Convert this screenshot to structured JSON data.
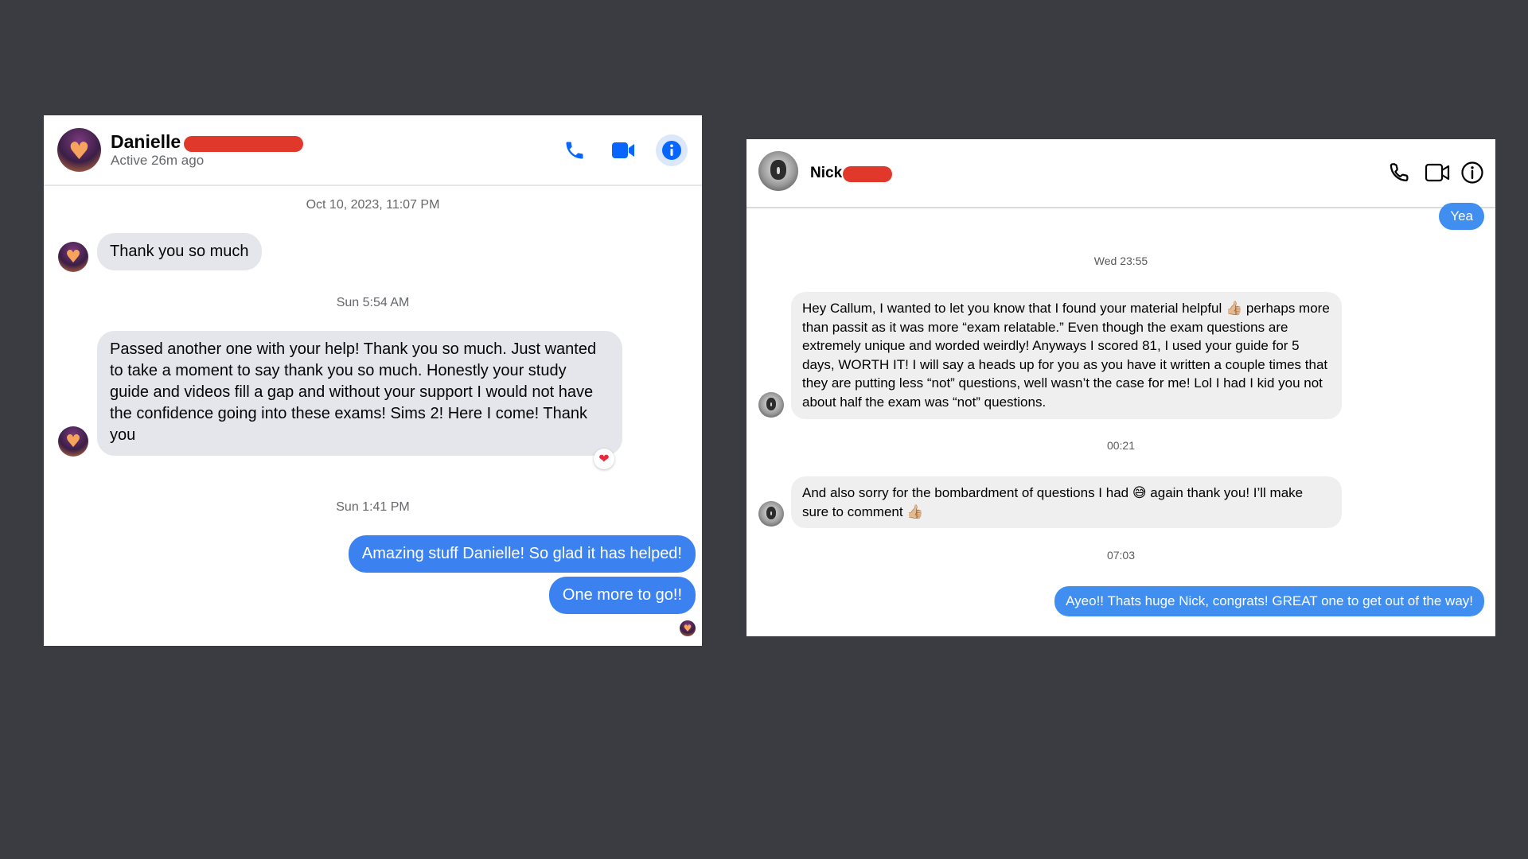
{
  "left_chat": {
    "contact_name": "Danielle",
    "active_status": "Active 26m ago",
    "header_icons": [
      "phone-icon",
      "video-icon",
      "info-icon"
    ],
    "accent_color": "#0866ff",
    "timestamps": [
      "Oct 10, 2023, 11:07 PM",
      "Sun 5:54 AM",
      "Sun 1:41 PM"
    ],
    "messages": [
      {
        "direction": "received",
        "text": "Thank you so much"
      },
      {
        "direction": "received",
        "text": "Passed another one with your help! Thank you so much. Just wanted to take a moment to say thank you so much. Honestly your study guide and videos fill a gap and without your support I would not have the confidence going into these exams! Sims 2! Here I come! Thank you",
        "reaction": "❤"
      },
      {
        "direction": "sent",
        "text": "Amazing stuff Danielle! So glad it has helped!"
      },
      {
        "direction": "sent",
        "text": "One more to go!!"
      }
    ]
  },
  "right_chat": {
    "contact_name": "Nick",
    "header_icons": [
      "phone-icon",
      "video-icon",
      "info-icon"
    ],
    "timestamps": [
      "Wed 23:55",
      "00:21",
      "07:03"
    ],
    "messages": [
      {
        "direction": "sent",
        "text": "Yea"
      },
      {
        "direction": "received",
        "text": "Hey Callum, I wanted to let you know that I found your material helpful 👍🏼 perhaps more than passit as it was more “exam relatable.” Even though the exam questions are extremely unique and worded weirdly! Anyways I scored 81, I used your guide for 5 days, WORTH IT! I will say a heads up for you as you have it written a couple times that they are putting less “not” questions, well wasn’t the case for me! Lol I had I kid you not about half the exam was “not” questions."
      },
      {
        "direction": "received",
        "text": "And also sorry for the bombardment of questions I had 😅 again thank you! I’ll make sure to comment 👍🏼"
      },
      {
        "direction": "sent",
        "text": "Ayeo!! Thats huge Nick, congrats! GREAT one to get out of the way!"
      }
    ]
  }
}
